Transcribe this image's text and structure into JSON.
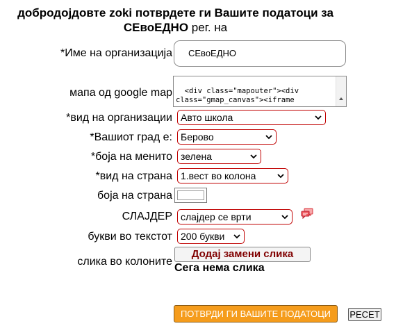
{
  "header": {
    "line1": "добродојдовте zoki потврдете ги Вашите податоци за",
    "brand": "СЕвоЕДНО",
    "line2_suffix": "рег. на"
  },
  "form": {
    "org_name_label": "*Име на организација",
    "org_name_value": "СЕвоЕДНО",
    "map_label": "мапа од google map",
    "map_value": "<div class=\"mapouter\"><div class=\"gmap_canvas\"><iframe",
    "org_type_label": "*вид на организации",
    "org_type_value": "Авто школа",
    "city_label": "*Вашиот град е:",
    "city_value": "Берово",
    "menu_color_label": "*боја на менито",
    "menu_color_value": "зелена",
    "page_type_label": "*вид на страна",
    "page_type_value": "1.вест во колона",
    "page_color_label": "боја на страна",
    "page_color_value": "#ffffff",
    "slider_label": "СЛАЈДЕР",
    "slider_value": "слајдер се врти",
    "text_letters_label": "букви во текстот",
    "text_letters_value": "200 букви",
    "column_image_label": "слика во колоните",
    "image_button_label": "Додај замени слика",
    "no_image_text": "Сега нема слика",
    "submit_label": "ПОТВРДИ ГИ ВАШИТЕ ПОДАТОЦИ",
    "reset_label": "РЕСЕТ"
  },
  "icons": {
    "select_arrow": "chevron-down-icon",
    "chat": "chat-bubble-icon"
  },
  "colors": {
    "select_border": "#c00000",
    "submit_bg": "#f59c1c",
    "image_button_text": "#800000",
    "chat_icon": "#d9363e"
  }
}
